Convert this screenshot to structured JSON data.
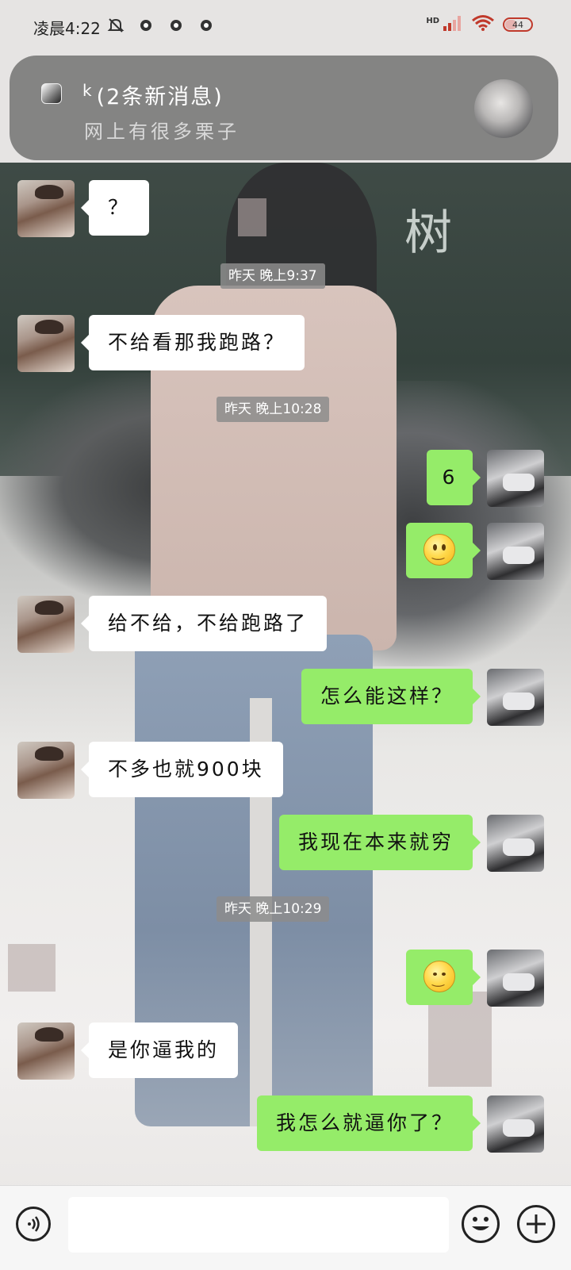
{
  "status_bar": {
    "time": "凌晨4:22",
    "hd_label": "HD",
    "battery": "44"
  },
  "notification": {
    "sender": "k",
    "count_label": "(2条新消息)",
    "preview": "网上有很多栗子"
  },
  "messages": [
    {
      "type": "text",
      "side": "left",
      "text": "？"
    },
    {
      "type": "time",
      "text": "昨天 晚上9:37"
    },
    {
      "type": "text",
      "side": "left",
      "text": "不给看那我跑路？"
    },
    {
      "type": "time",
      "text": "昨天 晚上10:28"
    },
    {
      "type": "text",
      "side": "right",
      "text": "6"
    },
    {
      "type": "emoji",
      "side": "right",
      "icon": "smile-emoji"
    },
    {
      "type": "text",
      "side": "left",
      "text": "给不给，不给跑路了"
    },
    {
      "type": "text",
      "side": "right",
      "text": "怎么能这样？"
    },
    {
      "type": "text",
      "side": "left",
      "text": "不多也就900块"
    },
    {
      "type": "text",
      "side": "right",
      "text": "我现在本来就穷"
    },
    {
      "type": "time",
      "text": "昨天 晚上10:29"
    },
    {
      "type": "emoji",
      "side": "right",
      "icon": "drool-emoji"
    },
    {
      "type": "text",
      "side": "left",
      "text": "是你逼我的"
    },
    {
      "type": "text",
      "side": "right",
      "text": "我怎么就逼你了？"
    }
  ],
  "wallpaper": {
    "board_text": "树"
  },
  "input_bar": {
    "placeholder": ""
  },
  "colors": {
    "bubble_self": "#95ec69",
    "bubble_other": "#ffffff",
    "time_tag": "#8c8c8c"
  }
}
